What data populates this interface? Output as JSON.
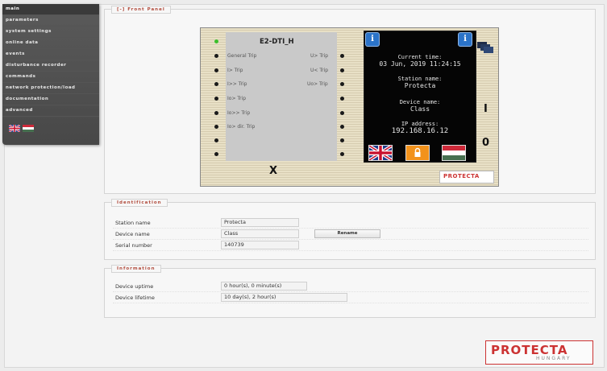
{
  "sidebar": {
    "items": [
      {
        "label": "main"
      },
      {
        "label": "parameters"
      },
      {
        "label": "system settings"
      },
      {
        "label": "online data"
      },
      {
        "label": "events"
      },
      {
        "label": "disturbance recorder"
      },
      {
        "label": "commands"
      },
      {
        "label": "network protection/load"
      },
      {
        "label": "documentation"
      },
      {
        "label": "advanced"
      }
    ]
  },
  "front_panel": {
    "legend": "[-] Front Panel",
    "device_title": "E2-DTI_H",
    "left_leds": [
      {
        "label": "General Trip"
      },
      {
        "label": "I> Trip"
      },
      {
        "label": "I>> Trip"
      },
      {
        "label": "Io> Trip"
      },
      {
        "label": "Io>> Trip"
      },
      {
        "label": "Io> dir. Trip"
      },
      {
        "label": ""
      },
      {
        "label": ""
      }
    ],
    "right_leds": [
      {
        "label": "U> Trip"
      },
      {
        "label": "U< Trip"
      },
      {
        "label": "Uo> Trip"
      }
    ],
    "screen": {
      "current_time_label": "Current time:",
      "current_time": "03 Jun, 2019 11:24:15",
      "station_label": "Station name:",
      "station": "Protecta",
      "device_label": "Device name:",
      "device": "Class",
      "ip_label": "IP address:",
      "ip": "192.168.16.12"
    },
    "close_symbol": "X",
    "key_i": "I",
    "key_o": "0",
    "logo_text": "PROTECTA"
  },
  "identification": {
    "legend": "Identification",
    "rows": [
      {
        "label": "Station name",
        "value": "Protecta"
      },
      {
        "label": "Device name",
        "value": "Class"
      },
      {
        "label": "Serial number",
        "value": "140739"
      }
    ],
    "rename_label": "Rename"
  },
  "information": {
    "legend": "Information",
    "rows": [
      {
        "label": "Device uptime",
        "value": "0 hour(s), 0 minute(s)"
      },
      {
        "label": "Device lifetime",
        "value": "10 day(s), 2 hour(s)"
      }
    ]
  },
  "footer_logo": {
    "brand": "PROTECTA",
    "sub": "HUNGARY"
  },
  "colors": {
    "legend": "#b14b3c",
    "led_green": "#3bbf2c",
    "info_blue": "#2b73c8"
  }
}
